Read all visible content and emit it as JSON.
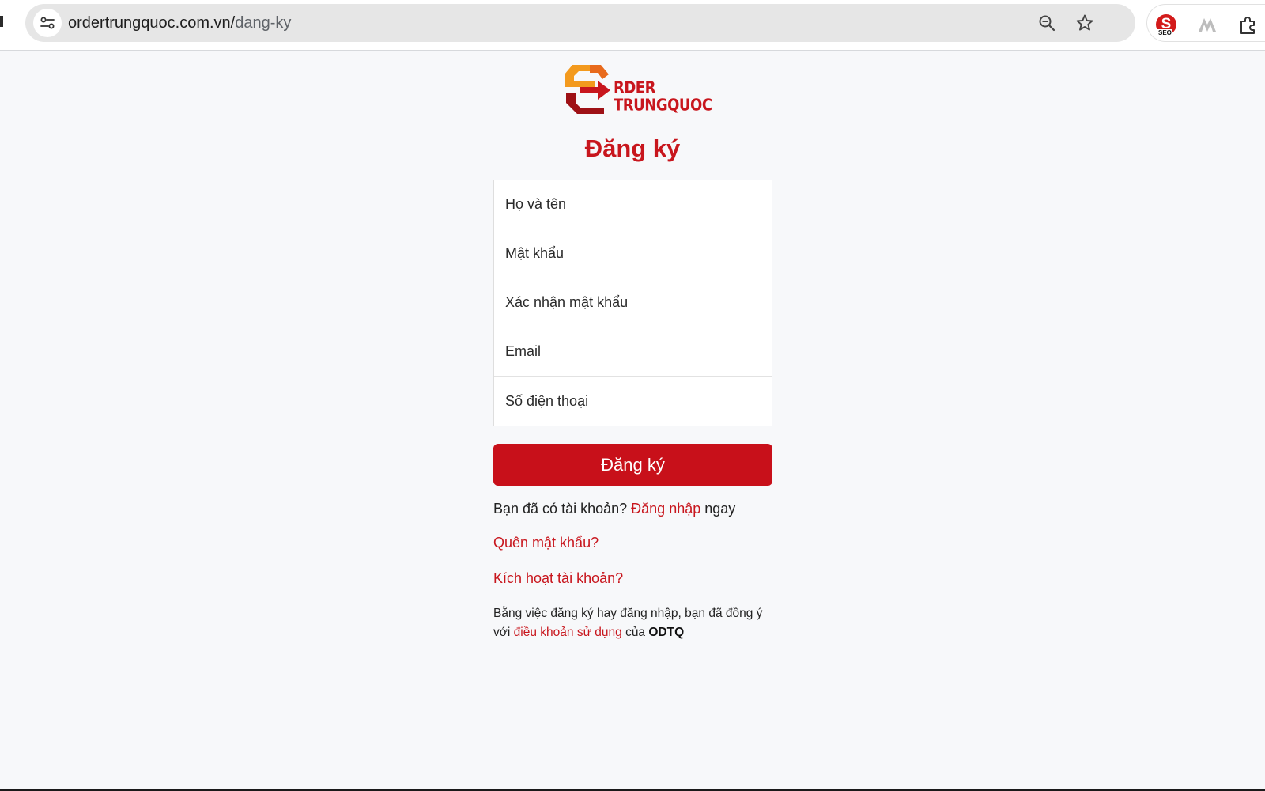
{
  "browser": {
    "url_host": "ordertrungquoc.com.vn/",
    "url_path": "dang-ky",
    "icons": [
      "site-info-icon",
      "zoom-out-icon",
      "bookmark-star-icon"
    ],
    "extensions": [
      {
        "name": "seo-extension-icon",
        "letter": "S",
        "label": "SEO"
      },
      {
        "name": "mountain-extension-icon"
      },
      {
        "name": "extensions-puzzle-icon"
      }
    ]
  },
  "logo": {
    "line1": "RDER",
    "line2": "TRUNGQUOC",
    "colors": {
      "orange": "#f39a1e",
      "red": "#c8161d",
      "dark_red": "#9e1116"
    }
  },
  "form": {
    "title": "Đăng ký",
    "fields": [
      {
        "name": "full-name-field",
        "placeholder": "Họ và tên",
        "type": "text"
      },
      {
        "name": "password-field",
        "placeholder": "Mật khẩu",
        "type": "password"
      },
      {
        "name": "confirm-password-field",
        "placeholder": "Xác nhận mật khẩu",
        "type": "password"
      },
      {
        "name": "email-field",
        "placeholder": "Email",
        "type": "email"
      },
      {
        "name": "phone-field",
        "placeholder": "Số điện thoại",
        "type": "tel"
      }
    ],
    "submit_label": "Đăng ký"
  },
  "links": {
    "have_account_prefix": "Bạn đã có tài khoản?",
    "login_link": "Đăng nhập",
    "login_suffix": "ngay",
    "forgot_password": "Quên mật khẩu?",
    "activate_account": "Kích hoạt tài khoản?"
  },
  "terms": {
    "prefix": "Bằng việc đăng ký hay đăng nhập, bạn đã đồng ý với",
    "link": "điều khoản sử dụng",
    "middle": "của",
    "brand": "ODTQ"
  },
  "colors": {
    "accent": "#c8161d",
    "button": "#c8101a",
    "background": "#f7f8fa"
  }
}
